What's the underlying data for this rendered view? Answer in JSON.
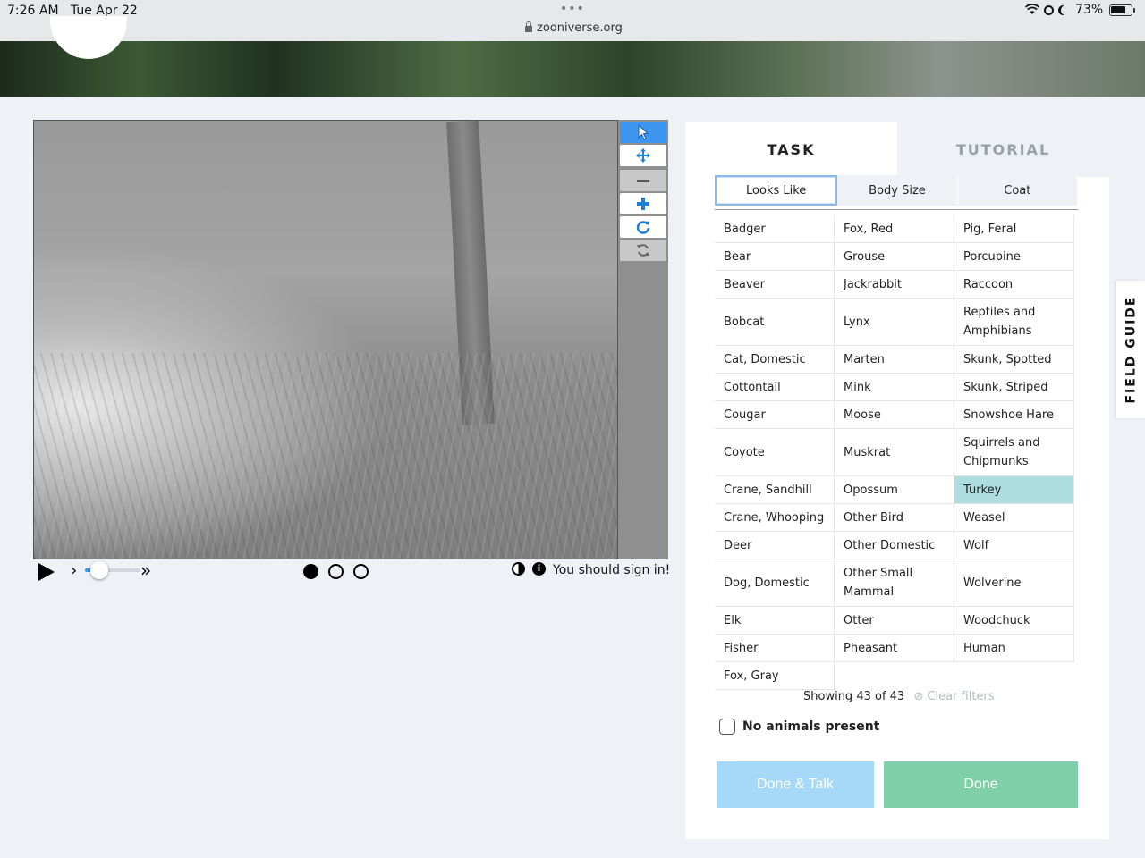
{
  "status_bar": {
    "time": "7:26 AM",
    "date": "Tue Apr 22",
    "url": "zooniverse.org",
    "battery": "73%",
    "battery_level": 0.73,
    "dots": "•••"
  },
  "viewer": {
    "signin_text": "You should sign in!",
    "frames": 3,
    "active_frame": 1,
    "playback_speed_fraction": 0.25,
    "tools": [
      "pointer-icon",
      "move-icon",
      "zoom-out-icon",
      "zoom-in-icon",
      "rotate-icon",
      "reset-icon"
    ]
  },
  "task_panel": {
    "tabs": [
      "TASK",
      "TUTORIAL"
    ],
    "filters": [
      "Looks Like",
      "Body Size",
      "Coat"
    ],
    "species": [
      [
        "Badger",
        "Fox, Red",
        "Pig, Feral"
      ],
      [
        "Bear",
        "Grouse",
        "Porcupine"
      ],
      [
        "Beaver",
        "Jackrabbit",
        "Raccoon"
      ],
      [
        "Bobcat",
        "Lynx",
        "Reptiles and Amphibians"
      ],
      [
        "Cat, Domestic",
        "Marten",
        "Skunk, Spotted"
      ],
      [
        "Cottontail",
        "Mink",
        "Skunk, Striped"
      ],
      [
        "Cougar",
        "Moose",
        "Snowshoe Hare"
      ],
      [
        "Coyote",
        "Muskrat",
        "Squirrels and Chipmunks"
      ],
      [
        "Crane, Sandhill",
        "Opossum",
        "Turkey"
      ],
      [
        "Crane, Whooping",
        "Other Bird",
        "Weasel"
      ],
      [
        "Deer",
        "Other Domestic",
        "Wolf"
      ],
      [
        "Dog, Domestic",
        "Other Small Mammal",
        "Wolverine"
      ],
      [
        "Elk",
        "Otter",
        "Woodchuck"
      ],
      [
        "Fisher",
        "Pheasant",
        "Human"
      ],
      [
        "Fox, Gray",
        "",
        ""
      ]
    ],
    "selected_species": "Turkey",
    "showing": "Showing 43 of 43",
    "clear_filters": "Clear filters",
    "no_animals": "No animals present",
    "done_talk": "Done & Talk",
    "done": "Done"
  },
  "field_guide": "FIELD GUIDE",
  "colors": {
    "accent_blue": "#3d96f0",
    "selected": "#addde0",
    "done_green": "#7fcfa9",
    "done_talk_blue": "#a6d9f7"
  }
}
